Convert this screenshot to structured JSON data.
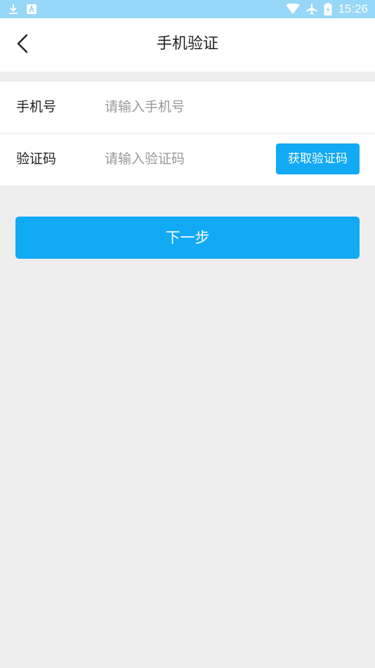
{
  "status_bar": {
    "time": "15:26",
    "left_icons": [
      "download-icon",
      "font-a-icon"
    ],
    "right_icons": [
      "wifi-icon",
      "airplane-icon",
      "battery-charging-icon"
    ],
    "background": "#97d7f7"
  },
  "header": {
    "back_icon": "chevron-left-icon",
    "title": "手机验证"
  },
  "form": {
    "phone": {
      "label": "手机号",
      "value": "",
      "placeholder": "请输入手机号"
    },
    "code": {
      "label": "验证码",
      "value": "",
      "placeholder": "请输入验证码",
      "button_label": "获取验证码"
    }
  },
  "actions": {
    "next_label": "下一步"
  },
  "colors": {
    "accent": "#12a9f5",
    "page_background": "#eeeeee"
  }
}
